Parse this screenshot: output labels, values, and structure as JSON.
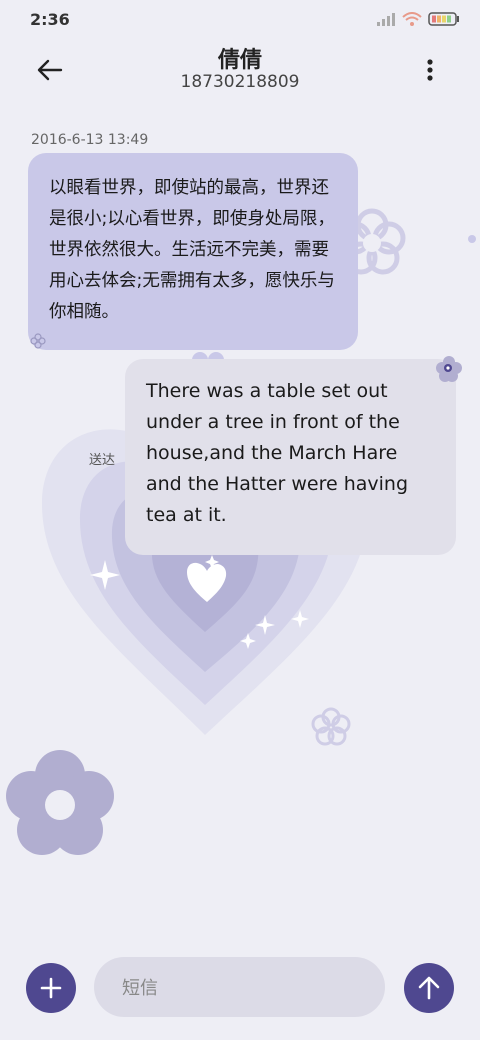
{
  "status": {
    "time": "2:36"
  },
  "header": {
    "contact_name": "倩倩",
    "phone": "18730218809"
  },
  "thread": {
    "timestamp": "2016-6-13 13:49",
    "messages": [
      {
        "direction": "incoming",
        "text": "以眼看世界，即使站的最高，世界还是很小;以心看世界，即使身处局限，世界依然很大。生活远不完美，需要用心去体会;无需拥有太多，愿快乐与你相随。"
      },
      {
        "direction": "outgoing",
        "text": "There was a table set out under a tree in front of the house,and the March Hare and the Hatter were having tea at it.",
        "status": "送达"
      }
    ]
  },
  "composer": {
    "placeholder": "短信"
  },
  "icons": {
    "back": "arrow-left-icon",
    "more": "more-vertical-icon",
    "add": "plus-icon",
    "send": "arrow-up-icon"
  },
  "colors": {
    "background": "#eeeef5",
    "incoming_bubble": "#c9c8e8",
    "outgoing_bubble": "#e1e0ea",
    "accent": "#4f4890"
  }
}
